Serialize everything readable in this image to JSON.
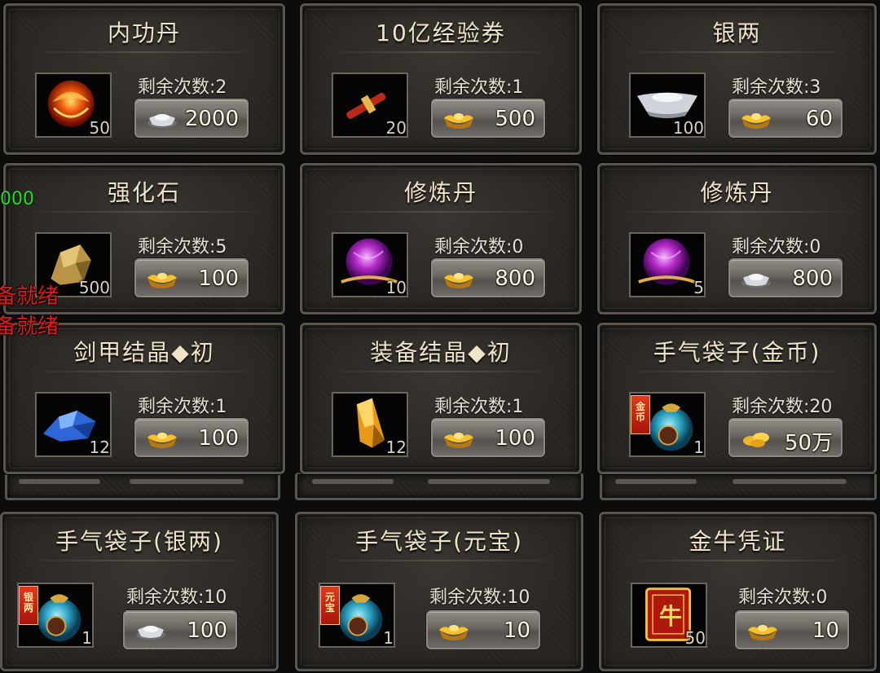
{
  "remaining_label": "剩余次数:",
  "items": [
    {
      "title": "内功丹",
      "qty": "50",
      "remaining": "2",
      "price": "2000",
      "currency": "silver-icon",
      "art": "red-pill"
    },
    {
      "title": "10亿经验券",
      "qty": "20",
      "remaining": "1",
      "price": "500",
      "currency": "gold-ingot-icon",
      "art": "scroll"
    },
    {
      "title": "银两",
      "qty": "100",
      "remaining": "3",
      "price": "60",
      "currency": "gold-ingot-icon",
      "art": "silver-ingot"
    },
    {
      "title": "强化石",
      "qty": "500",
      "remaining": "5",
      "price": "100",
      "currency": "gold-ingot-icon",
      "art": "gold-ore"
    },
    {
      "title": "修炼丹",
      "qty": "10",
      "remaining": "0",
      "price": "800",
      "currency": "gold-ingot-icon",
      "art": "purple-orb"
    },
    {
      "title": "修炼丹",
      "qty": "5",
      "remaining": "0",
      "price": "800",
      "currency": "silver-icon",
      "art": "purple-orb"
    },
    {
      "title": "剑甲结晶◆初",
      "qty": "12",
      "remaining": "1",
      "price": "100",
      "currency": "gold-ingot-icon",
      "art": "blue-crystal"
    },
    {
      "title": "装备结晶◆初",
      "qty": "12",
      "remaining": "1",
      "price": "100",
      "currency": "gold-ingot-icon",
      "art": "orange-crystal"
    },
    {
      "title": "手气袋子(金币)",
      "qty": "1",
      "remaining": "20",
      "price": "50万",
      "currency": "gold-coin-icon",
      "art": "lucky-bag",
      "ribbon": "金币"
    },
    {
      "title": "手气袋子(银两)",
      "qty": "1",
      "remaining": "10",
      "price": "100",
      "currency": "silver-icon",
      "art": "lucky-bag",
      "ribbon": "银两"
    },
    {
      "title": "手气袋子(元宝)",
      "qty": "1",
      "remaining": "10",
      "price": "10",
      "currency": "gold-ingot-icon",
      "art": "lucky-bag",
      "ribbon": "元宝"
    },
    {
      "title": "金牛凭证",
      "qty": "50",
      "remaining": "0",
      "price": "10",
      "currency": "gold-ingot-icon",
      "art": "bull-voucher",
      "ribbon_text": "牛"
    }
  ],
  "overlay": {
    "green_text": "000",
    "red_text_1": "备就绪",
    "red_text_2": "备就绪"
  },
  "colors": {
    "gold": "#f2b51e",
    "silver": "#c9ced4",
    "title_text": "#efe3c8"
  }
}
